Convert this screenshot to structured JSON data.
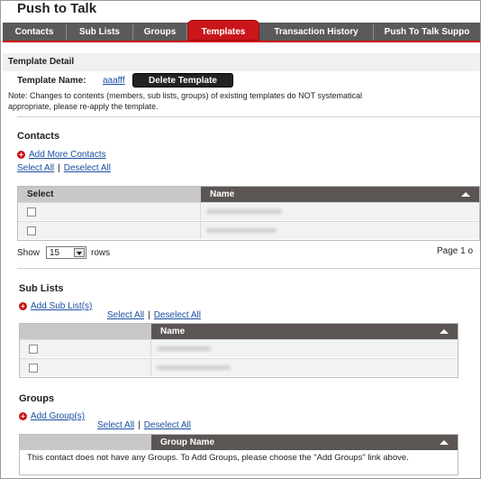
{
  "app": {
    "title": "Push to Talk"
  },
  "tabs": [
    {
      "label": "Contacts"
    },
    {
      "label": "Sub Lists"
    },
    {
      "label": "Groups"
    },
    {
      "label": "Templates",
      "active": true
    },
    {
      "label": "Transaction History"
    },
    {
      "label": "Push To Talk Suppo"
    }
  ],
  "template_detail": {
    "heading": "Template Detail",
    "name_label": "Template Name:",
    "name_value": "aaafff",
    "delete_button": "Delete Template",
    "note_line1": "Note: Changes to contents (members, sub lists, groups) of existing templates do NOT systematical",
    "note_line2": "appropriate, please re-apply the template."
  },
  "contacts": {
    "heading": "Contacts",
    "add_link": "Add More Contacts",
    "select_all": "Select All",
    "separator": "|",
    "deselect_all": "Deselect All",
    "columns": [
      "Select",
      "Name"
    ],
    "rows": [
      {
        "checked": false
      },
      {
        "checked": false
      }
    ],
    "pager": {
      "show_label": "Show",
      "page_size": "15",
      "rows_label": "rows",
      "page_text": "Page 1 o"
    }
  },
  "sub_lists": {
    "heading": "Sub Lists",
    "add_link": "Add Sub List(s)",
    "select_all": "Select All",
    "separator": "|",
    "deselect_all": "Deselect All",
    "columns": [
      "",
      "Name"
    ],
    "rows": [
      {
        "checked": false
      },
      {
        "checked": false
      }
    ]
  },
  "groups": {
    "heading": "Groups",
    "add_link": "Add Group(s)",
    "select_all": "Select All",
    "separator": "|",
    "deselect_all": "Deselect All",
    "columns": [
      "",
      "Group Name"
    ],
    "empty_message": "This contact does not have any Groups. To Add Groups, please choose the \"Add Groups\" link above."
  },
  "colors": {
    "accent": "#c9161b",
    "tabbar": "#5a5a5a",
    "grid_header": "#5b5554",
    "link": "#1a4fa0"
  }
}
